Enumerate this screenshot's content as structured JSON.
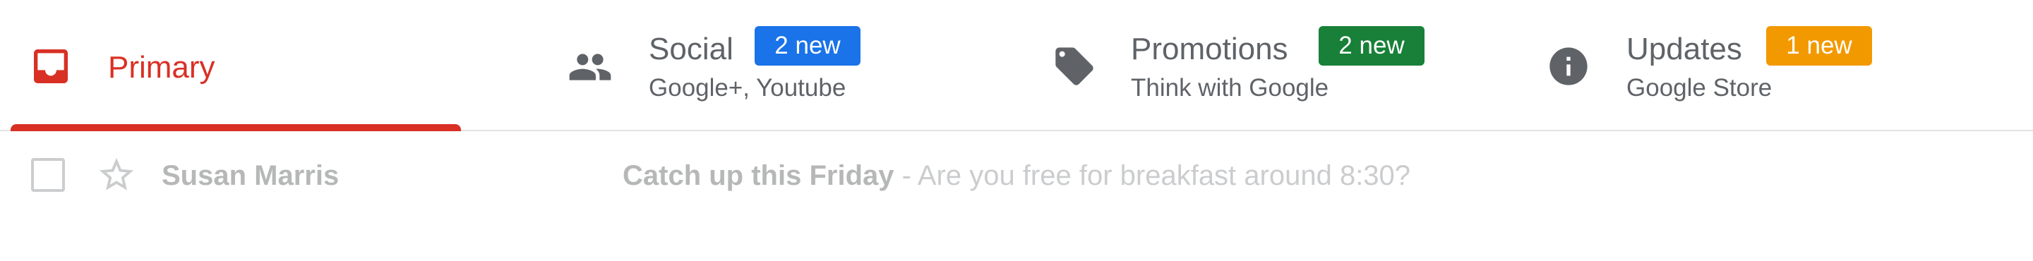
{
  "tabs": [
    {
      "title": "Primary",
      "subtitle": "",
      "badge": "",
      "icon": "inbox-icon",
      "active": true
    },
    {
      "title": "Social",
      "subtitle": "Google+, Youtube",
      "badge": "2 new",
      "badge_color": "#1a73e8",
      "icon": "people-icon"
    },
    {
      "title": "Promotions",
      "subtitle": "Think with Google",
      "badge": "2 new",
      "badge_color": "#188038",
      "icon": "tag-icon"
    },
    {
      "title": "Updates",
      "subtitle": "Google Store",
      "badge": "1 new",
      "badge_color": "#f29900",
      "icon": "info-icon"
    }
  ],
  "colors": {
    "accent": "#d93025",
    "text": "#5f6368"
  },
  "email": {
    "sender": "Susan Marris",
    "subject": "Catch up this Friday",
    "separator": " - ",
    "snippet": "Are you free for breakfast around 8:30?"
  }
}
